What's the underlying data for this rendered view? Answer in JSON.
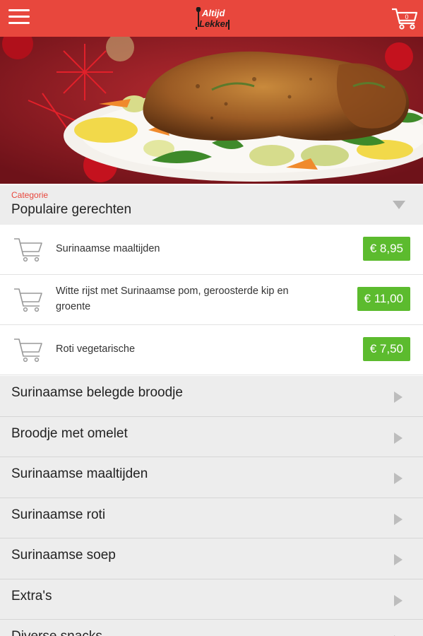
{
  "header": {
    "logo_line1": "Altijd",
    "logo_line2": "Lekker",
    "cart_count": "0",
    "icons": {
      "menu": "hamburger-menu-icon",
      "cart": "shopping-cart-icon"
    }
  },
  "category_select": {
    "label": "Categorie",
    "value": "Populaire gerechten"
  },
  "items": [
    {
      "name": "Surinaamse maaltijden",
      "price": "€ 8,95"
    },
    {
      "name": "Witte rijst met Surinaamse pom, geroosterde kip en groente",
      "price": "€ 11,00"
    },
    {
      "name": "Roti vegetarische",
      "price": "€ 7,50"
    }
  ],
  "categories": [
    "Surinaamse belegde broodje",
    "Broodje met omelet",
    "Surinaamse maaltijden",
    "Surinaamse roti",
    "Surinaamse soep",
    "Extra's",
    "Diverse snacks"
  ],
  "colors": {
    "brand_red": "#e8473d",
    "price_green": "#5cbb2e",
    "row_bg": "#ededed"
  }
}
